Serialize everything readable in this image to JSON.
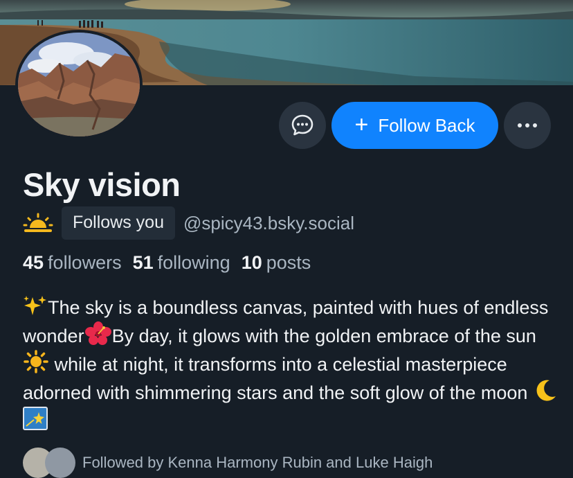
{
  "profile": {
    "display_name": "Sky vision",
    "follows_you_badge": "Follows you",
    "handle": "@spicy43.bsky.social",
    "status_icon": "sunrise-icon"
  },
  "actions": {
    "message_icon": "chat-bubble-icon",
    "follow_label": "Follow Back",
    "more_icon": "ellipsis-icon"
  },
  "stats": {
    "followers_count": "45",
    "followers_label": "followers",
    "following_count": "51",
    "following_label": "following",
    "posts_count": "10",
    "posts_label": "posts"
  },
  "bio": {
    "line1": "The sky is a boundless canvas, painted with hues of endless wonder",
    "line2": "By day, it glows with the golden embrace of the sun",
    "line3": "while at night, it transforms into a celestial masterpiece adorned with shimmering stars and the soft glow of the moon"
  },
  "followed_by": {
    "text": "Followed by Kenna Harmony Rubin and Luke Haigh"
  },
  "colors": {
    "background": "#161e27",
    "accent": "#1083fe",
    "muted_text": "#aab6c2",
    "button_bg": "#2a3440"
  }
}
